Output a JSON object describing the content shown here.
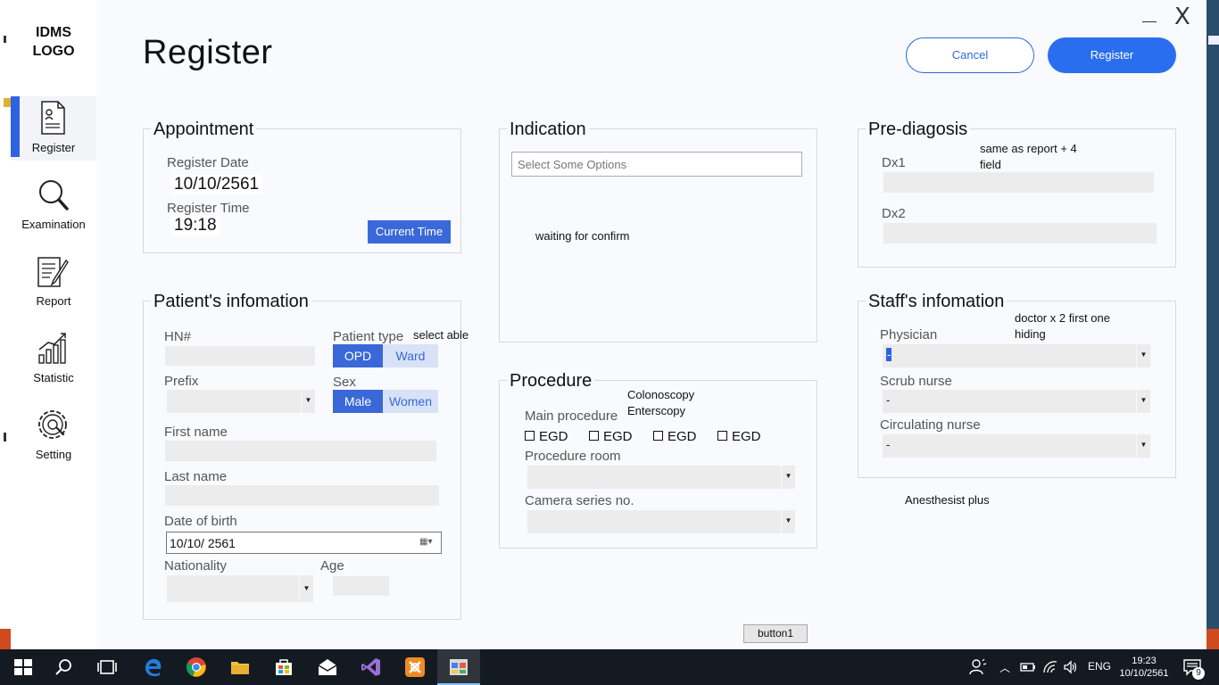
{
  "app": {
    "logo": "IDMS LOGO",
    "title": "Register",
    "minimize_label": "_",
    "close_label": "X"
  },
  "sidebar": {
    "items": [
      {
        "label": "Register",
        "icon": "register-icon"
      },
      {
        "label": "Examination",
        "icon": "magnifier-icon"
      },
      {
        "label": "Report",
        "icon": "report-icon"
      },
      {
        "label": "Statistic",
        "icon": "statistic-icon"
      },
      {
        "label": "Setting",
        "icon": "gear-icon"
      }
    ]
  },
  "header": {
    "cancel_label": "Cancel",
    "register_label": "Register"
  },
  "appointment": {
    "title": "Appointment",
    "date_label": "Register Date",
    "date_value": "10/10/2561",
    "time_label": "Register Time",
    "time_value": "19:18",
    "current_time_button": "Current Time"
  },
  "indication": {
    "title": "Indication",
    "placeholder": "Select Some Options",
    "note": "waiting for confirm"
  },
  "prediagnosis": {
    "title": "Pre-diagosis",
    "dx1_label": "Dx1",
    "dx2_label": "Dx2",
    "note": "same as report + 4 field"
  },
  "patient": {
    "title": "Patient's infomation",
    "hn_label": "HN#",
    "patient_type_label": "Patient type",
    "patient_type_note": "select able",
    "patient_type_options": [
      "OPD",
      "Ward"
    ],
    "patient_type_selected": "OPD",
    "prefix_label": "Prefix",
    "sex_label": "Sex",
    "sex_options": [
      "Male",
      "Women"
    ],
    "sex_selected": "Male",
    "first_name_label": "First name",
    "last_name_label": "Last name",
    "dob_label": "Date of birth",
    "dob_value": "10/10/  2561",
    "nationality_label": "Nationality",
    "age_label": "Age"
  },
  "procedure": {
    "title": "Procedure",
    "main_label": "Main procedure",
    "note_line1": "Colonoscopy",
    "note_line2": "Enterscopy",
    "checkboxes": [
      "EGD",
      "EGD",
      "EGD",
      "EGD"
    ],
    "room_label": "Procedure room",
    "camera_label": "Camera series no."
  },
  "staff": {
    "title": "Staff's infomation",
    "note": "doctor x 2 first one hiding",
    "physician_label": "Physician",
    "physician_value": "-",
    "scrub_label": "Scrub nurse",
    "scrub_value": "-",
    "circulating_label": "Circulating nurse",
    "circulating_value": "-",
    "anesthesist_note": "Anesthesist plus"
  },
  "footer": {
    "button1_label": "button1"
  },
  "taskbar": {
    "language": "ENG",
    "time": "19:23",
    "date": "10/10/2561",
    "notification_count": "9"
  }
}
